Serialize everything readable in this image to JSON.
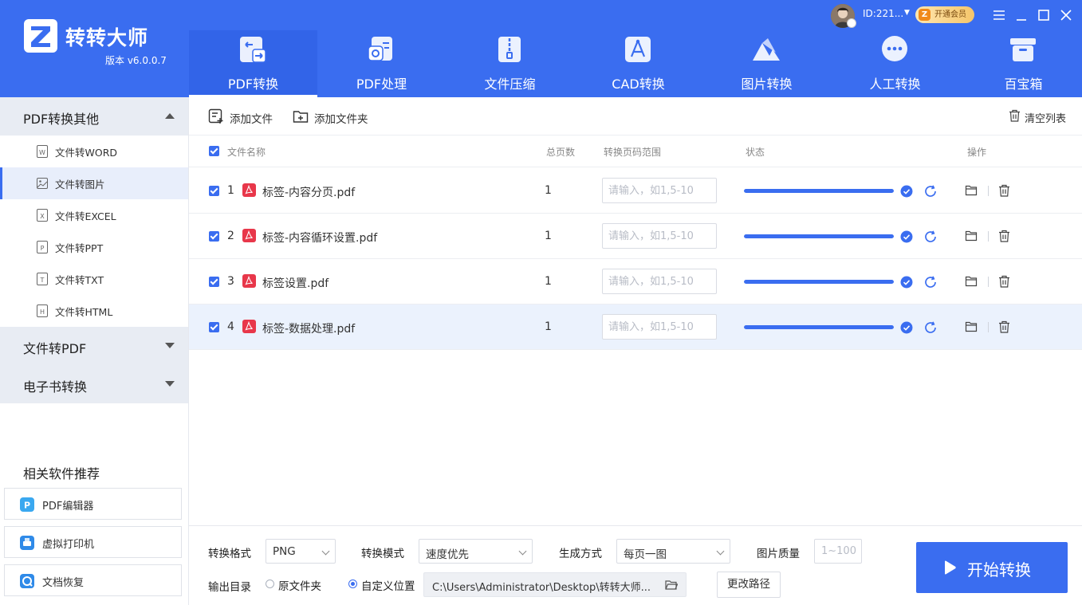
{
  "app": {
    "title": "转转大师",
    "version": "版本 v6.0.0.7"
  },
  "user": {
    "id": "ID:221...",
    "vip_label": "开通会员"
  },
  "nav": [
    {
      "label": "PDF转换",
      "icon": "pdf-convert-icon",
      "active": true
    },
    {
      "label": "PDF处理",
      "icon": "pdf-process-icon",
      "active": false
    },
    {
      "label": "文件压缩",
      "icon": "zip-icon",
      "active": false
    },
    {
      "label": "CAD转换",
      "icon": "cad-icon",
      "active": false
    },
    {
      "label": "图片转换",
      "icon": "image-icon",
      "active": false
    },
    {
      "label": "人工转换",
      "icon": "chat-icon",
      "active": false
    },
    {
      "label": "百宝箱",
      "icon": "toolbox-icon",
      "active": false
    }
  ],
  "sidebar": {
    "groups": [
      {
        "label": "PDF转换其他",
        "expanded": true,
        "items": [
          {
            "label": "文件转WORD",
            "icon": "W",
            "active": false
          },
          {
            "label": "文件转图片",
            "icon": "image",
            "active": true
          },
          {
            "label": "文件转EXCEL",
            "icon": "X",
            "active": false
          },
          {
            "label": "文件转PPT",
            "icon": "P",
            "active": false
          },
          {
            "label": "文件转TXT",
            "icon": "T",
            "active": false
          },
          {
            "label": "文件转HTML",
            "icon": "H",
            "active": false
          }
        ]
      },
      {
        "label": "文件转PDF",
        "expanded": false
      },
      {
        "label": "电子书转换",
        "expanded": false
      }
    ],
    "recommend_title": "相关软件推荐",
    "recommend": [
      {
        "label": "PDF编辑器",
        "icon": "pdf-editor-icon"
      },
      {
        "label": "虚拟打印机",
        "icon": "printer-icon"
      },
      {
        "label": "文档恢复",
        "icon": "recovery-icon"
      }
    ]
  },
  "toolbar": {
    "add_file": "添加文件",
    "add_folder": "添加文件夹",
    "clear_list": "清空列表"
  },
  "table": {
    "columns": {
      "name": "文件名称",
      "pages": "总页数",
      "range": "转换页码范围",
      "status": "状态",
      "actions": "操作"
    },
    "range_placeholder": "请输入，如1,5-10",
    "rows": [
      {
        "index": "1",
        "name": "标签-内容分页.pdf",
        "pages": "1",
        "progress": 1.0,
        "highlighted": false
      },
      {
        "index": "2",
        "name": "标签-内容循环设置.pdf",
        "pages": "1",
        "progress": 1.0,
        "highlighted": false
      },
      {
        "index": "3",
        "name": "标签设置.pdf",
        "pages": "1",
        "progress": 1.0,
        "highlighted": false
      },
      {
        "index": "4",
        "name": "标签-数据处理.pdf",
        "pages": "1",
        "progress": 1.0,
        "highlighted": true
      }
    ]
  },
  "bottom": {
    "format_label": "转换格式",
    "format_value": "PNG",
    "mode_label": "转换模式",
    "mode_value": "速度优先",
    "gen_label": "生成方式",
    "gen_value": "每页一图",
    "quality_label": "图片质量",
    "quality_placeholder": "1~100",
    "output_label": "输出目录",
    "radio_original": "原文件夹",
    "radio_custom": "自定义位置",
    "path": "C:\\Users\\Administrator\\Desktop\\转转大师...",
    "change_path": "更改路径",
    "start": "开始转换"
  },
  "colors": {
    "brand": "#3a6df0",
    "pdf_red": "#e8374a"
  }
}
